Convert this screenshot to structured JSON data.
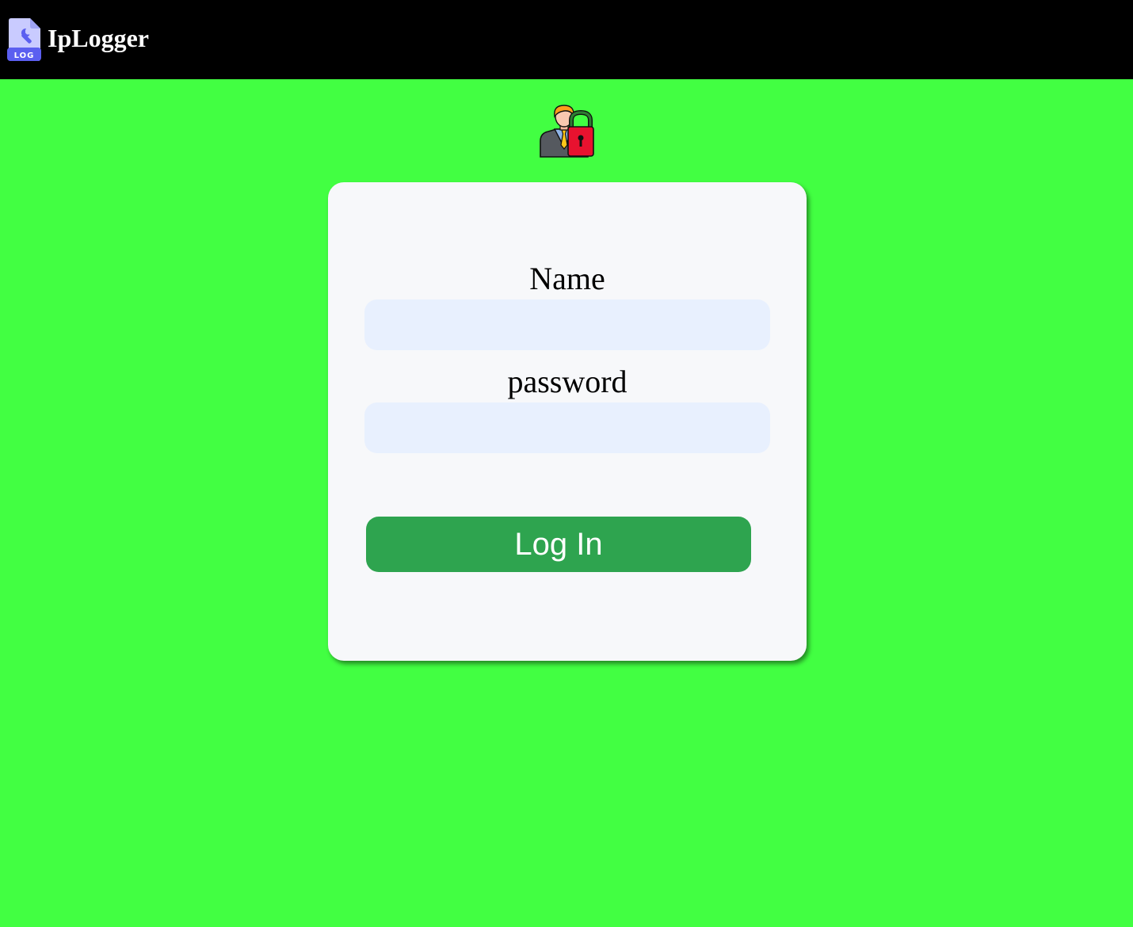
{
  "header": {
    "logo_icon": "log-file-wrench-icon",
    "logo_text": "LOG",
    "app_name": "IpLogger"
  },
  "login": {
    "illustration_icon": "user-with-padlock-icon",
    "name_label": "Name",
    "name_value": "",
    "password_label": "password",
    "password_value": "",
    "submit_label": "Log In"
  },
  "colors": {
    "page_background": "#42ff42",
    "topbar_background": "#000000",
    "card_background": "#f7f8fa",
    "input_background": "#e8f0fe",
    "button_background": "#2ea44f",
    "button_text": "#ffffff"
  }
}
